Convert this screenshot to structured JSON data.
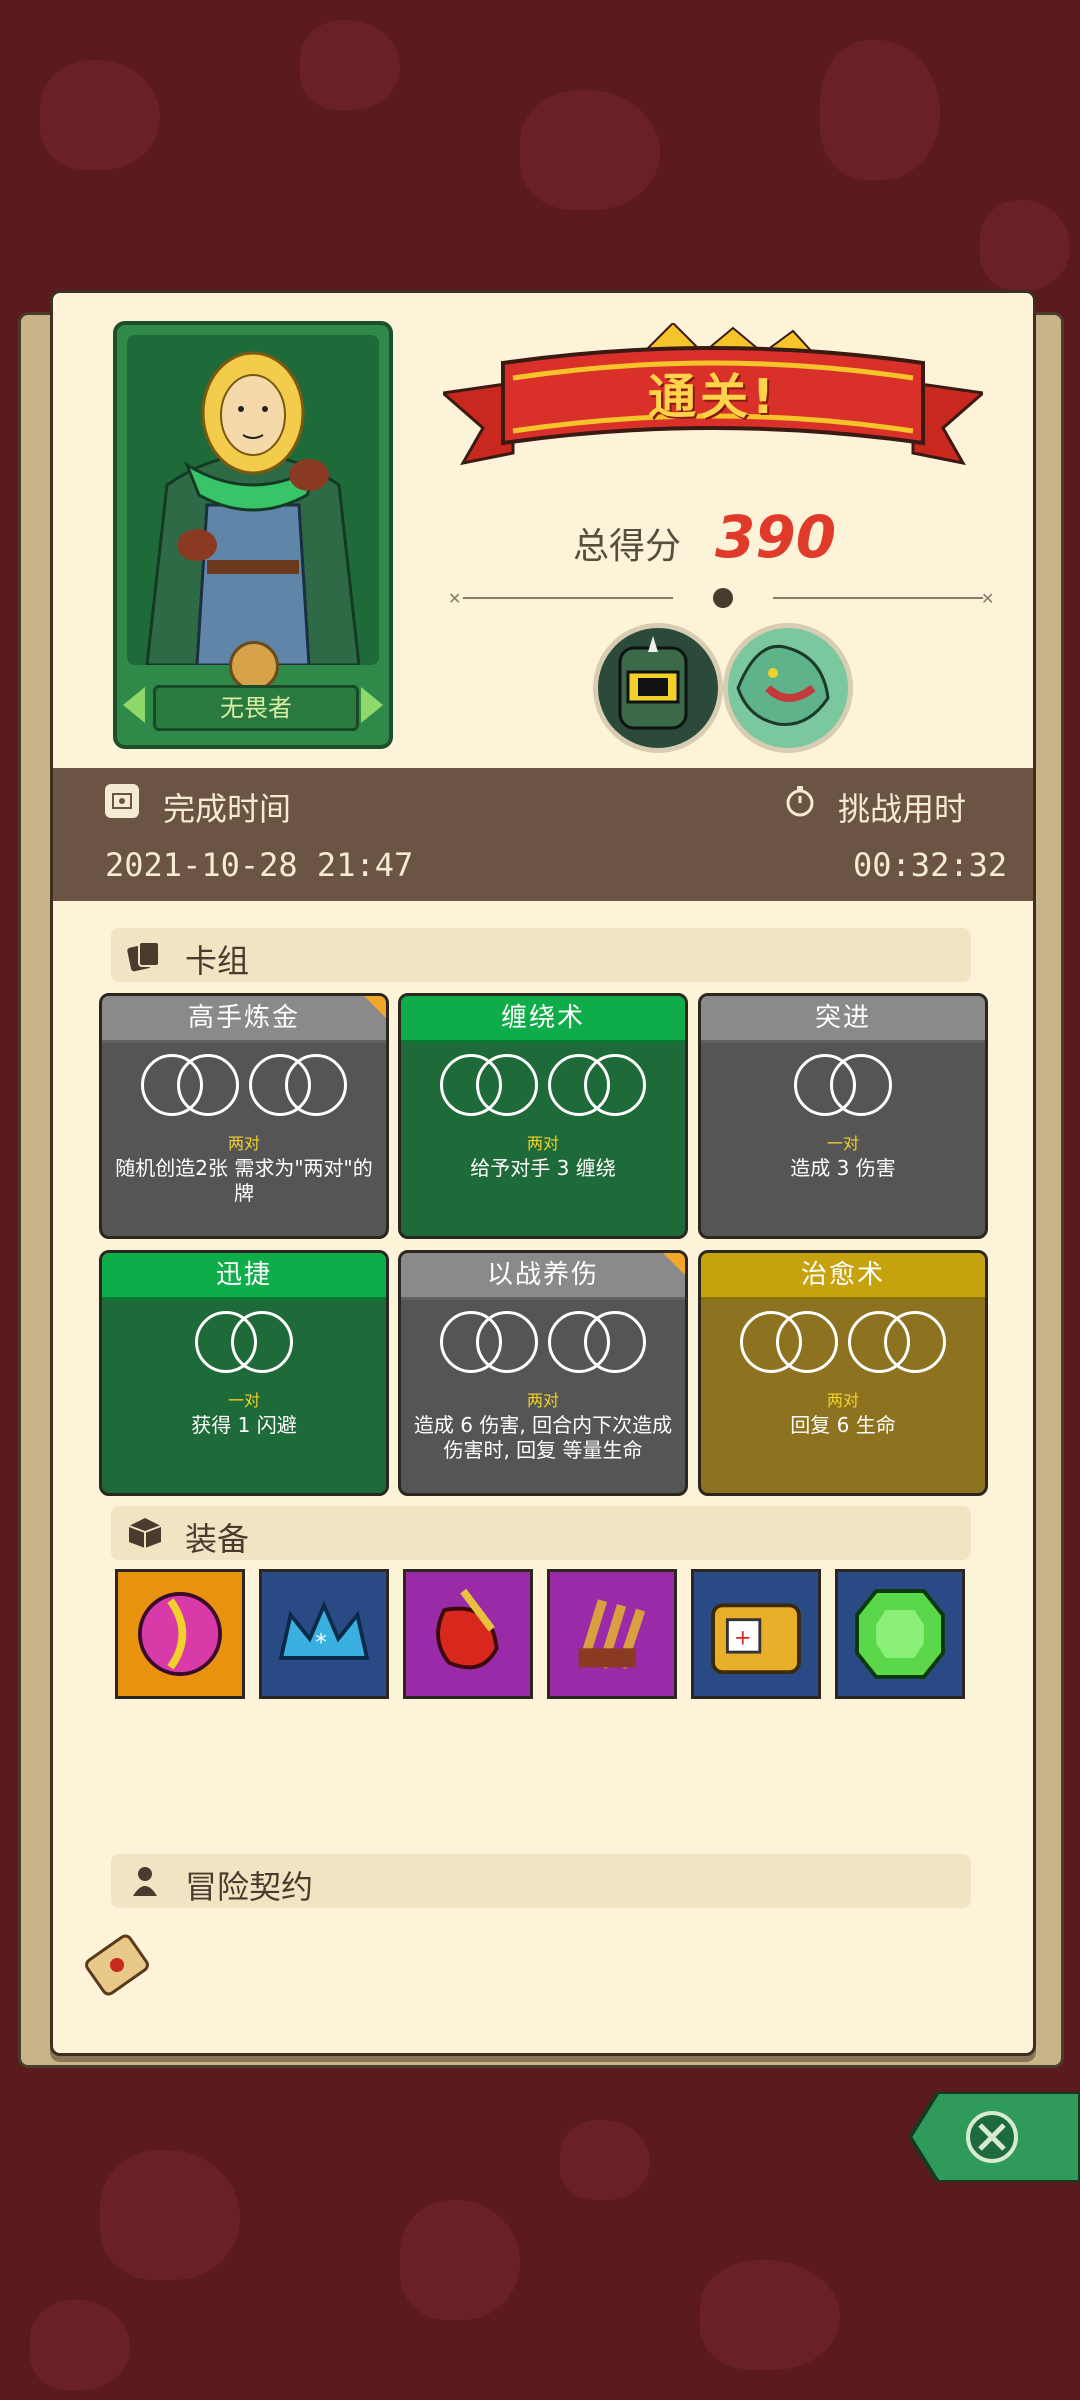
{
  "hero": {
    "name": "无畏者"
  },
  "banner": {
    "title": "通关!"
  },
  "score": {
    "label": "总得分",
    "value": "390"
  },
  "time": {
    "complete_label": "完成时间",
    "complete_value": "2021-10-28 21:47",
    "challenge_label": "挑战用时",
    "challenge_value": "00:32:32"
  },
  "sections": {
    "deck": "卡组",
    "equipment": "装备",
    "contract": "冒险契约"
  },
  "cards": [
    {
      "title": "高手炼金",
      "color": "grey",
      "rings": 4,
      "slot_label": "两对",
      "desc": "随机创造2张 需求为\"两对\"的牌",
      "upgraded": true
    },
    {
      "title": "缠绕术",
      "color": "green",
      "rings": 4,
      "slot_label": "两对",
      "desc": "给予对手 3 缠绕",
      "upgraded": false
    },
    {
      "title": "突进",
      "color": "grey",
      "rings": 2,
      "slot_label": "一对",
      "desc": "造成 3 伤害",
      "upgraded": false
    },
    {
      "title": "迅捷",
      "color": "green",
      "rings": 2,
      "slot_label": "一对",
      "desc": "获得 1 闪避",
      "upgraded": false
    },
    {
      "title": "以战养伤",
      "color": "grey",
      "rings": 4,
      "slot_label": "两对",
      "desc": "造成 6 伤害, 回合内下次造成伤害时, 回复 等量生命",
      "upgraded": true
    },
    {
      "title": "治愈术",
      "color": "gold",
      "rings": 4,
      "slot_label": "两对",
      "desc": "回复 6 生命",
      "upgraded": false
    }
  ],
  "equipment": [
    {
      "name": "orb-icon",
      "bg": "#e8920e"
    },
    {
      "name": "crown-icon",
      "bg": "#2a4a86"
    },
    {
      "name": "pepper-dagger-icon",
      "bg": "#9a2aa8"
    },
    {
      "name": "claw-icon",
      "bg": "#9a2aa8"
    },
    {
      "name": "dice-chest-icon",
      "bg": "#2a4a86"
    },
    {
      "name": "gem-icon",
      "bg": "#2a4a86"
    }
  ],
  "colors": {
    "accent_red": "#e03a2a",
    "paper": "#fdf3d8",
    "band": "#6b5444"
  }
}
